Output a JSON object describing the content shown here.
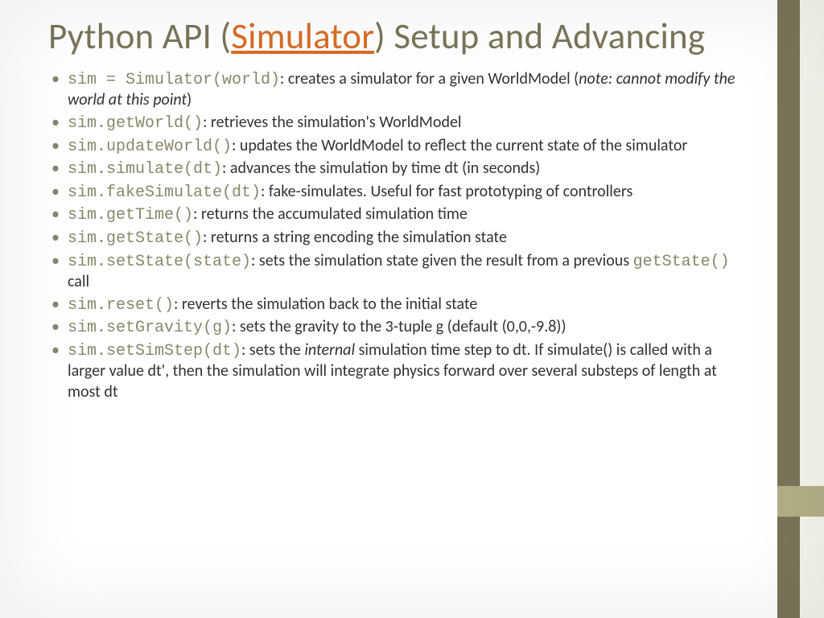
{
  "title": {
    "prefix": "Python API (",
    "link": "Simulator",
    "suffix": ") Setup and Advancing"
  },
  "bullets": [
    {
      "code": "sim = Simulator(world)",
      "desc_a": ": creates a simulator for a given WorldModel (",
      "ital": "note: cannot modify the world at this point",
      "desc_b": ")"
    },
    {
      "code": "sim.getWorld()",
      "desc_a": ": retrieves the simulation's WorldModel"
    },
    {
      "code": "sim.updateWorld()",
      "desc_a": ": updates the WorldModel to reflect the current state of the simulator"
    },
    {
      "code": "sim.simulate(dt)",
      "desc_a": ": advances the simulation by time dt (in seconds)"
    },
    {
      "code": "sim.fakeSimulate(dt)",
      "desc_a": ": fake-simulates.  Useful for fast prototyping of controllers"
    },
    {
      "code": "sim.getTime()",
      "desc_a": ": returns the accumulated simulation time"
    },
    {
      "code": "sim.getState()",
      "desc_a": ": returns a string encoding the simulation state"
    },
    {
      "code": "sim.setState(state)",
      "desc_a": ": sets the simulation state given the result from a previous ",
      "code2": "getState()",
      "desc_b": " call"
    },
    {
      "code": "sim.reset()",
      "desc_a": ": reverts the simulation back to the initial state"
    },
    {
      "code": "sim.setGravity(g)",
      "desc_a": ": sets the gravity to the 3-tuple g (default (0,0,-9.8))"
    },
    {
      "code": "sim.setSimStep(dt)",
      "desc_a": ": sets the ",
      "ital": "internal",
      "desc_b": " simulation time step to dt. If simulate() is called with a larger value dt', then the simulation will integrate physics forward over several substeps of length at most dt"
    }
  ]
}
